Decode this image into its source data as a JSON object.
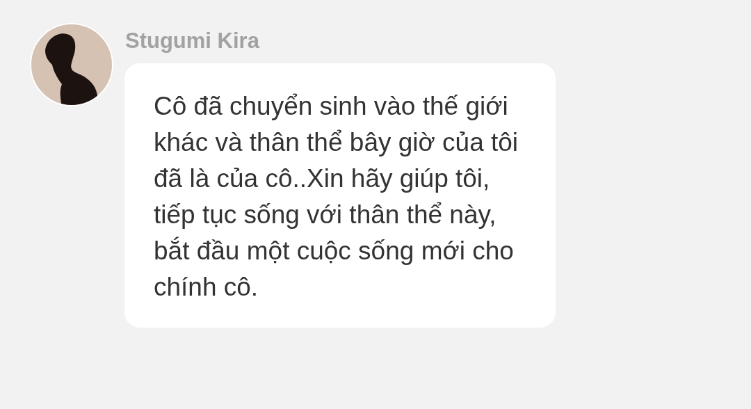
{
  "message": {
    "sender": "Stugumi Kira",
    "text": "Cô đã chuyển sinh vào thế giới khác và thân thể bây giờ của tôi đã là của cô..Xin hãy giúp tôi, tiếp tục sống với thân thể này, bắt đầu một cuộc sống mới cho chính cô."
  }
}
